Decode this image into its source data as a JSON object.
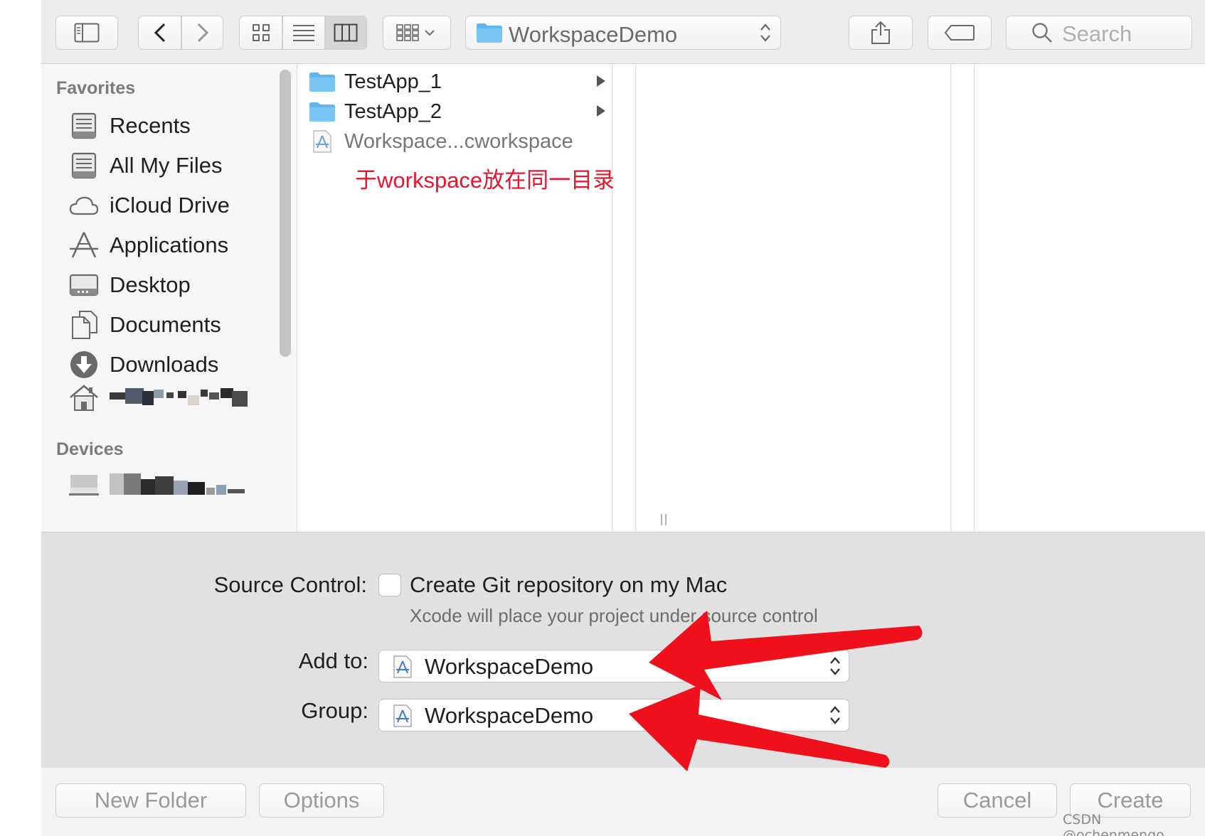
{
  "toolbar": {
    "path_label": "WorkspaceDemo",
    "search_placeholder": "Search",
    "icons": [
      "sidebar-toggle-icon",
      "back-chevron-icon",
      "forward-chevron-icon",
      "grid-view-icon",
      "list-view-icon",
      "column-view-icon",
      "arrange-icon",
      "folder-icon",
      "updown-chevron-icon",
      "share-icon",
      "tag-icon",
      "search-icon"
    ]
  },
  "sidebar": {
    "favorites_heading": "Favorites",
    "devices_heading": "Devices",
    "items": [
      {
        "label": "Recents",
        "icon": "recents-icon"
      },
      {
        "label": "All My Files",
        "icon": "all-files-icon"
      },
      {
        "label": "iCloud Drive",
        "icon": "cloud-icon"
      },
      {
        "label": "Applications",
        "icon": "applications-icon"
      },
      {
        "label": "Desktop",
        "icon": "desktop-icon"
      },
      {
        "label": "Documents",
        "icon": "documents-icon"
      },
      {
        "label": "Downloads",
        "icon": "downloads-icon"
      }
    ]
  },
  "browser": {
    "rows": [
      {
        "label": "TestApp_1",
        "kind": "folder"
      },
      {
        "label": "TestApp_2",
        "kind": "folder"
      },
      {
        "label": "Workspace...cworkspace",
        "kind": "workspace"
      }
    ],
    "annotation": "于workspace放在同一目录下"
  },
  "options": {
    "source_control_label": "Source Control:",
    "git_checkbox_label": "Create Git repository on my Mac",
    "git_checkbox_checked": false,
    "git_subtitle": "Xcode will place your project under source control",
    "add_to_label": "Add to:",
    "add_to_value": "WorkspaceDemo",
    "group_label": "Group:",
    "group_value": "WorkspaceDemo"
  },
  "footer": {
    "new_folder": "New Folder",
    "options": "Options",
    "cancel": "Cancel",
    "create": "Create"
  },
  "watermark": "CSDN @ochenmengo",
  "colors": {
    "annotation_red": "#e8142b",
    "arrow_red": "#f0101c",
    "folder_blue": "#5fb7ef"
  }
}
